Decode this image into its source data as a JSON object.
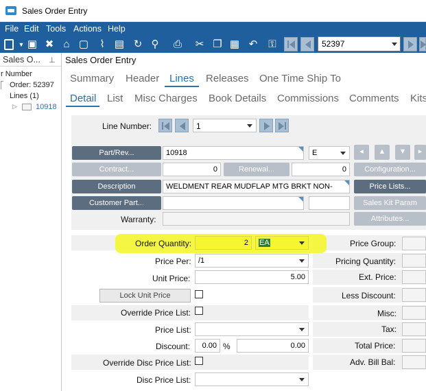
{
  "window": {
    "title": "Sales Order Entry"
  },
  "menu": [
    "File",
    "Edit",
    "Tools",
    "Actions",
    "Help"
  ],
  "toolbar": {
    "record_value": "52397"
  },
  "tree": {
    "header": "Sales O...",
    "items": [
      "r Number",
      "Order: 52397",
      "Lines (1)",
      "10918"
    ]
  },
  "form": {
    "title": "Sales Order Entry",
    "tabs": [
      "Summary",
      "Header",
      "Lines",
      "Releases",
      "One Time Ship To"
    ],
    "subtabs": [
      "Detail",
      "List",
      "Misc Charges",
      "Book Details",
      "Commissions",
      "Comments",
      "Kits"
    ],
    "line_number_label": "Line Number:",
    "line_number": "1",
    "part_rev_button": "Part/Rev...",
    "part_value": "10918",
    "rev_value": "E",
    "contract_button": "Contract...",
    "contract_value": "0",
    "renewal_button": "Renewal...",
    "renewal_value": "0",
    "configuration_button": "Configuration...",
    "description_button": "Description",
    "description_value": "WELDMENT REAR MUDFLAP MTG BRKT NON-",
    "price_lists_button": "Price Lists...",
    "customer_part_button": "Customer Part...",
    "sales_kit_button": "Sales Kit Param",
    "warranty_label": "Warranty:",
    "attributes_button": "Attributes...",
    "order_quantity_label": "Order Quantity:",
    "order_quantity": "2",
    "uom": "EA",
    "price_per_label": "Price Per:",
    "price_per": "/1",
    "unit_price_label": "Unit Price:",
    "unit_price": "5.00",
    "lock_unit_price_button": "Lock Unit Price",
    "override_price_list_label": "Override Price List:",
    "price_list_label": "Price List:",
    "discount_label": "Discount:",
    "discount_pct": "0.00",
    "pct_symbol": "%",
    "discount_amount": "0.00",
    "override_disc_label": "Override Disc Price List:",
    "disc_price_list_label": "Disc Price List:",
    "price_group_label": "Price Group:",
    "pricing_quantity_label": "Pricing Quantity:",
    "ext_price_label": "Ext. Price:",
    "less_discount_label": "Less Discount:",
    "misc_label": "Misc:",
    "tax_label": "Tax:",
    "total_price_label": "Total Price:",
    "adv_bill_bal_label": "Adv. Bill Bal:"
  },
  "colors": {
    "menubar": "#1f5f9e",
    "active_tab": "#2a6fb0",
    "highlight": "#f5f531",
    "dark_button": "#5d6d80"
  }
}
